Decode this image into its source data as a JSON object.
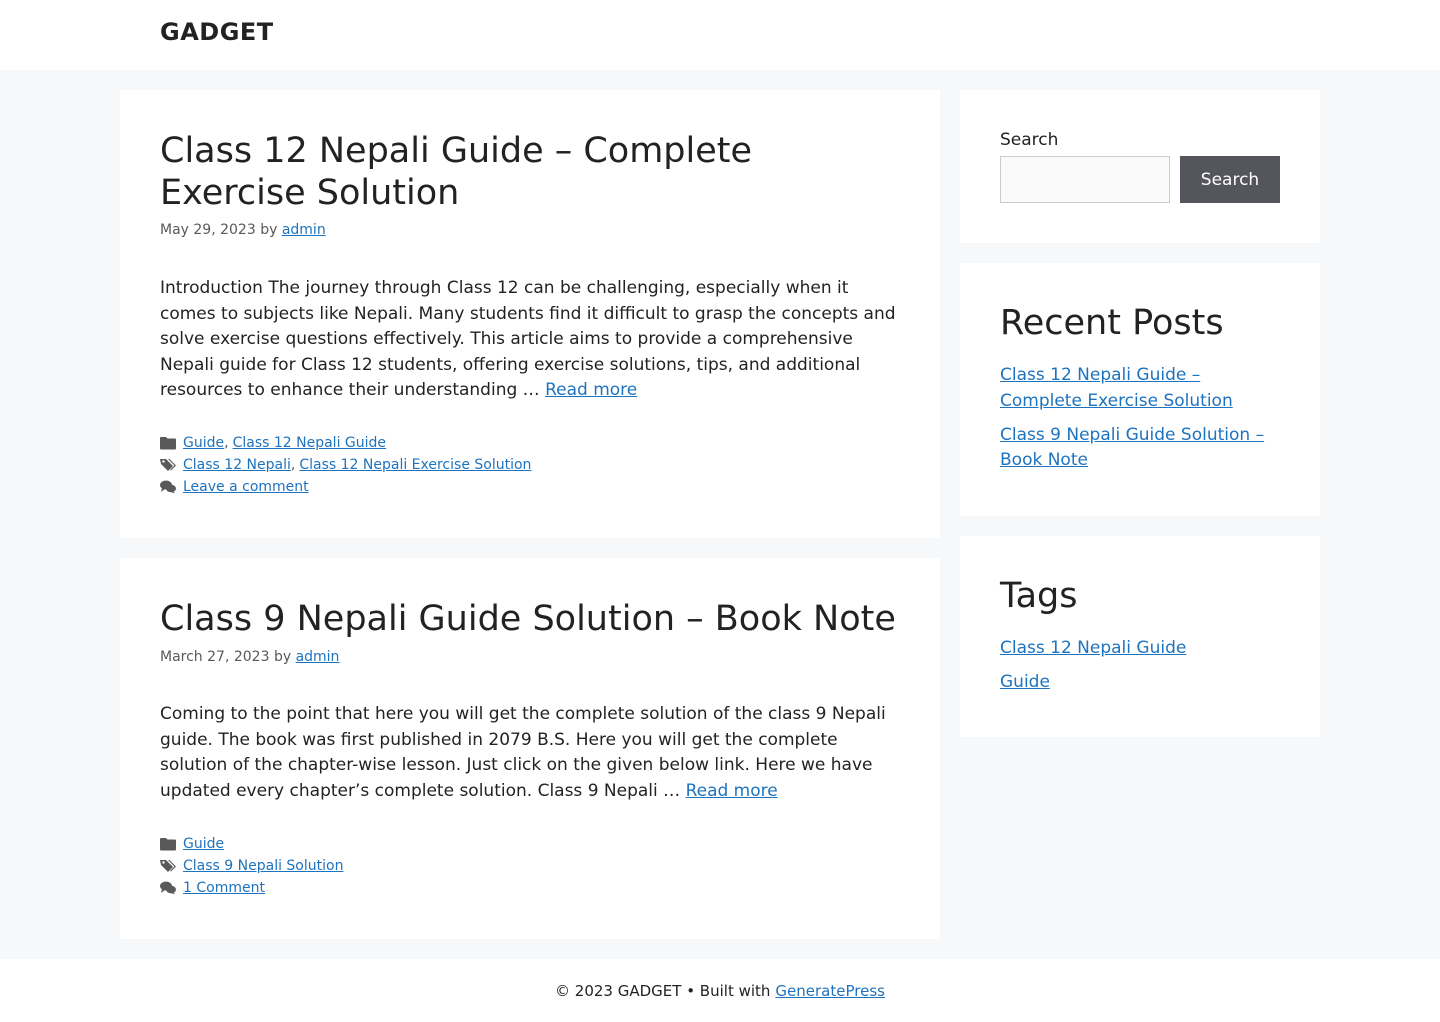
{
  "site": {
    "title": "GADGET"
  },
  "posts": [
    {
      "title": "Class 12 Nepali Guide – Complete Exercise Solution",
      "date": "May 29, 2023",
      "by": "by",
      "author": "admin",
      "excerpt": "Introduction The journey through Class 12 can be challenging, especially when it comes to subjects like Nepali. Many students find it difficult to grasp the concepts and solve exercise questions effectively. This article aims to provide a comprehensive Nepali guide for Class 12 students, offering exercise solutions, tips, and additional resources to enhance their understanding …",
      "read_more": "Read more",
      "categories": [
        "Guide",
        "Class 12 Nepali Guide"
      ],
      "tags": [
        "Class 12 Nepali",
        "Class 12 Nepali Exercise Solution"
      ],
      "comments": "Leave a comment"
    },
    {
      "title": "Class 9 Nepali Guide Solution – Book Note",
      "date": "March 27, 2023",
      "by": "by",
      "author": "admin",
      "excerpt": "Coming to the point that here you will get the complete solution of the class 9 Nepali guide. The book was first published in 2079 B.S. Here you will get the complete solution of the chapter-wise lesson. Just click on the given below link. Here we have updated every chapter’s complete solution. Class 9 Nepali …",
      "read_more": "Read more",
      "categories": [
        "Guide"
      ],
      "tags": [
        "Class 9 Nepali Solution"
      ],
      "comments": "1 Comment"
    }
  ],
  "sidebar": {
    "search": {
      "label": "Search",
      "placeholder": "",
      "button": "Search"
    },
    "recent_posts": {
      "title": "Recent Posts",
      "items": [
        "Class 12 Nepali Guide – Complete Exercise Solution",
        "Class 9 Nepali Guide Solution – Book Note"
      ]
    },
    "tags": {
      "title": "Tags",
      "items": [
        "Class 12 Nepali Guide",
        "Guide"
      ]
    }
  },
  "footer": {
    "copyright": "© 2023 GADGET • Built with",
    "link": "GeneratePress"
  },
  "icons": {
    "category": "folder-icon",
    "tag": "tags-icon",
    "comments": "comments-icon"
  },
  "colors": {
    "link": "#1e73be",
    "button": "#55555e",
    "background": "#f7f8f9",
    "meta_icon": "#595959"
  }
}
